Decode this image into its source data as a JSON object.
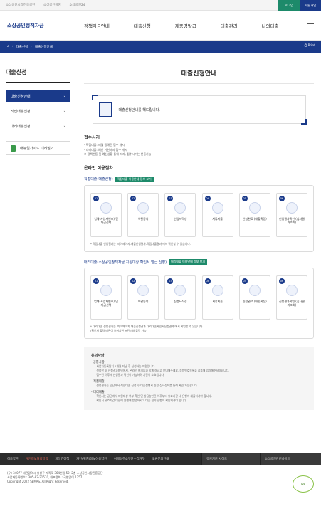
{
  "topbar": {
    "links": [
      "소상공인시장진흥공단",
      "소상공인마당",
      "소상공인24"
    ],
    "login": "로그인",
    "join": "회원가입",
    "login_color": "#1d8a6a",
    "join_color": "#1a3a8a"
  },
  "header": {
    "logo": "소상공인정책자금",
    "gnb": [
      "정책자금안내",
      "대출신청",
      "제증명발급",
      "대출관리",
      "나의대출"
    ]
  },
  "path": {
    "home_icon": "home-icon",
    "items": [
      "대출신청",
      "대출신청안내"
    ],
    "print": "Print"
  },
  "sidebar": {
    "title": "대출신청",
    "items": [
      {
        "label": "대출신청안내"
      },
      {
        "label": "직접대출신청"
      },
      {
        "label": "대리대출신청"
      }
    ],
    "manual_button": "매뉴얼가이드 내려받기"
  },
  "main": {
    "title": "대출신청안내",
    "intro_text": "대출신청안내를 해드립니다.",
    "reception_heading": "접수시기",
    "reception_lines": [
      "- 직접대출: 매월 정해진 접수 개시",
      "- 대리대출: 예산 기한까지 접수 개시",
      "※ 정책변동 및 예산상황 등에 따라, 접수시기는 변동가능"
    ],
    "online_heading": "온라인 이용절차",
    "direct_flow": {
      "title": "직접대출(대출신청)",
      "tag": "직접대출 이용안내 정보 보기",
      "steps": [
        {
          "num": "01",
          "label": "업체(사업자번호) 및 자금선택"
        },
        {
          "num": "02",
          "label": "약관동의"
        },
        {
          "num": "03",
          "label": "신청서작성"
        },
        {
          "num": "04",
          "label": "서류제출"
        },
        {
          "num": "05",
          "label": "신청완료 (대출확정)"
        },
        {
          "num": "06",
          "label": "신청결과확인 (심사결과조회)"
        }
      ],
      "note": "* 직접대출 신청결과는 '마이페이지-대출신청결과-직접대출결과'에서 확인할 수 있습니다."
    },
    "agency_flow": {
      "title": "대리대출(소상공인정책자금 지원대상 확인서 발급 신청)",
      "tag": "대리대출 이용안내 정보 보기",
      "steps": [
        {
          "num": "01",
          "label": "업체(사업자번호) 및 자금선택"
        },
        {
          "num": "02",
          "label": "약관동의"
        },
        {
          "num": "03",
          "label": "신청서작성"
        },
        {
          "num": "04",
          "label": "서류제출"
        },
        {
          "num": "05",
          "label": "신청완료 (대출확정)"
        },
        {
          "num": "06",
          "label": "신청결과확인 (심사결과조회)"
        }
      ],
      "note": "* 대리대출 신청결과는 '마이페이지-대출신청결과-대리대출확인서신청결과'에서 확인할 수 있습니다.\n(확인서 출력 버튼이 보여지면 프린터와 출력 가능)"
    },
    "notice": {
      "heading": "유의사항",
      "groups": [
        {
          "title": "- 공통사항",
          "lines": [
            "· 사업자등록된지 1개월 지난 후 신청하는 지원입니다.",
            "· 신청한 후 신청결과화면에서, 온라인 쓸기능과 함께 하시고 안내해주세요. 증빙번호목록을 참조해 입력해주셔야합니다.",
            "· 접수된 이후에 신청결과 확인이 가능하며 기간이 소요됩니다."
          ]
        },
        {
          "title": "- 직접대출",
          "lines": [
            "· 신청결과는 공단에서 직접대출 신청 후 대출실행시 신청·심사정보를 통해 확인 가능합니다."
          ]
        },
        {
          "title": "- 대리대출",
          "lines": [
            "· 확인서는 공단에서 지원대상 여부 확인 및 발급승인된 이후부터 유효기간 내 은행에 제출하셔야 합니다.",
            "· 확인서 유효기간 이전에 은행에 방문하시고 대출 협약 진행이 확인되셔야 합니다."
          ]
        }
      ]
    }
  },
  "footer_nav": {
    "items": [
      "이용약관",
      "개인정보처리방침",
      "저작권정책",
      "개인(위치)정보이용약관",
      "이메일주소무단수집거부",
      "오류문의안내"
    ],
    "select1": "유관기관 사이트",
    "select2": "소상공인관련사이트"
  },
  "footer": {
    "address": "(우) 34077 대전광역시 유성구 지족로 364번길 52, 2층 소상공인시장진흥공단",
    "phone": "사업자등록번호 : 305-82-21570, 대표전화 : 국번없이 1357",
    "copyright": "Copyright 2022 SEMAS, All Right Reserved.",
    "badge": "WA"
  }
}
